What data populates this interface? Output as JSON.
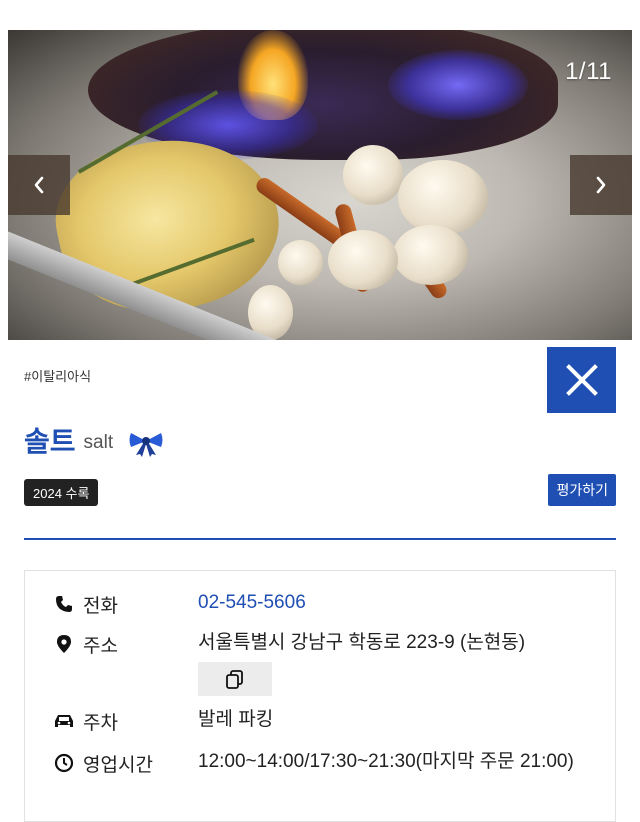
{
  "gallery": {
    "counter": "1/11",
    "prev_icon": "chevron-left-icon",
    "next_icon": "chevron-right-icon"
  },
  "restaurant": {
    "category": "#이탈리아식",
    "name_ko": "솔트",
    "name_en": "salt",
    "year_badge": "2024 수록",
    "rate_label": "평가하기",
    "ribbon_icon": "blue-ribbon-icon"
  },
  "info": {
    "phone_label": "전화",
    "phone_value": "02-545-5606",
    "address_label": "주소",
    "address_value": "서울특별시 강남구 학동로 223-9 (논현동)",
    "parking_label": "주차",
    "parking_value": "발레 파킹",
    "hours_label": "영업시간",
    "hours_value": "12:00~14:00/17:30~21:30(마지막 주문 21:00)"
  },
  "colors": {
    "accent": "#1f4fb3",
    "badge": "#222222",
    "copy_bg": "#ececec"
  }
}
